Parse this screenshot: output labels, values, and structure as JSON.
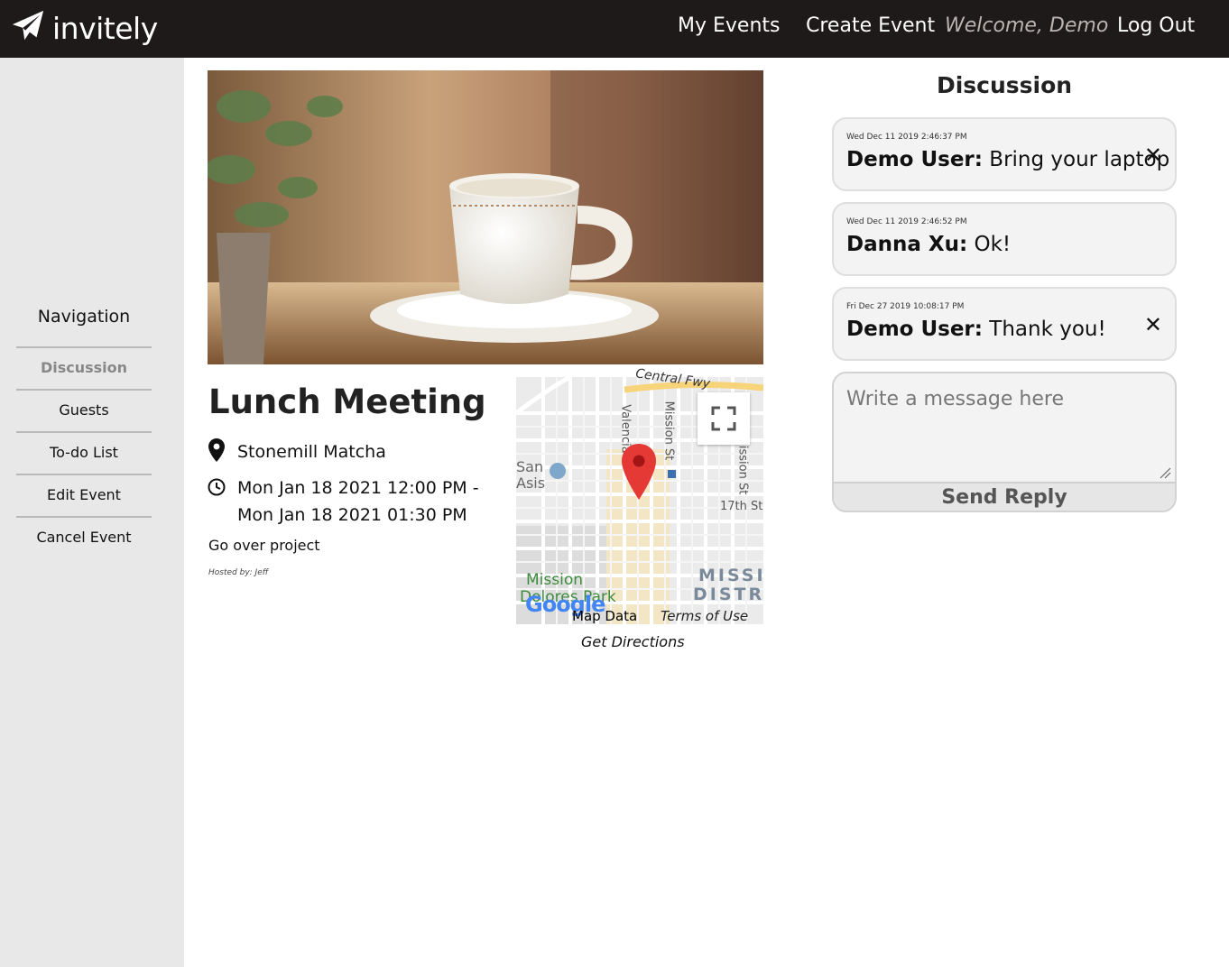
{
  "header": {
    "brand": "invitely",
    "my_events": "My Events",
    "create_event": "Create Event",
    "welcome": "Welcome, Demo",
    "logout": "Log Out"
  },
  "sidebar": {
    "title": "Navigation",
    "items": [
      {
        "label": "Discussion",
        "active": true
      },
      {
        "label": "Guests",
        "active": false
      },
      {
        "label": "To-do List",
        "active": false
      },
      {
        "label": "Edit Event",
        "active": false
      },
      {
        "label": "Cancel Event",
        "active": false
      }
    ]
  },
  "event": {
    "title": "Lunch Meeting",
    "location": "Stonemill Matcha",
    "time_start": "Mon Jan 18 2021 12:00 PM -",
    "time_end": "Mon Jan 18 2021 01:30 PM",
    "description": "Go over project",
    "hosted_by": "Hosted by: Jeff"
  },
  "map": {
    "street_labels": [
      "Central Fwy",
      "Valencia",
      "Mission St",
      "Mission St",
      "17th St",
      "San",
      "Asis",
      "Mission",
      "Dolores Park",
      "MISSI",
      "DISTR"
    ],
    "brand": "Google",
    "map_data": "Map Data",
    "terms": "Terms of Use",
    "directions": "Get Directions"
  },
  "discussion": {
    "title": "Discussion",
    "messages": [
      {
        "time": "Wed Dec 11 2019 2:46:37 PM",
        "author": "Demo User:",
        "text": " Bring your laptop",
        "deletable": true
      },
      {
        "time": "Wed Dec 11 2019 2:46:52 PM",
        "author": "Danna Xu:",
        "text": " Ok!",
        "deletable": false
      },
      {
        "time": "Fri Dec 27 2019 10:08:17 PM",
        "author": "Demo User:",
        "text": " Thank you!",
        "deletable": true
      }
    ],
    "close_glyph": "✕",
    "placeholder": "Write a message here",
    "send_label": "Send Reply"
  },
  "icons": {
    "logo": "paper-plane-icon",
    "location": "map-pin-icon",
    "time": "clock-icon",
    "expand": "fullscreen-icon"
  },
  "colors": {
    "header_bg": "#1e1a19",
    "sidebar_bg": "#e8e8e8",
    "pin": "#e53935"
  }
}
